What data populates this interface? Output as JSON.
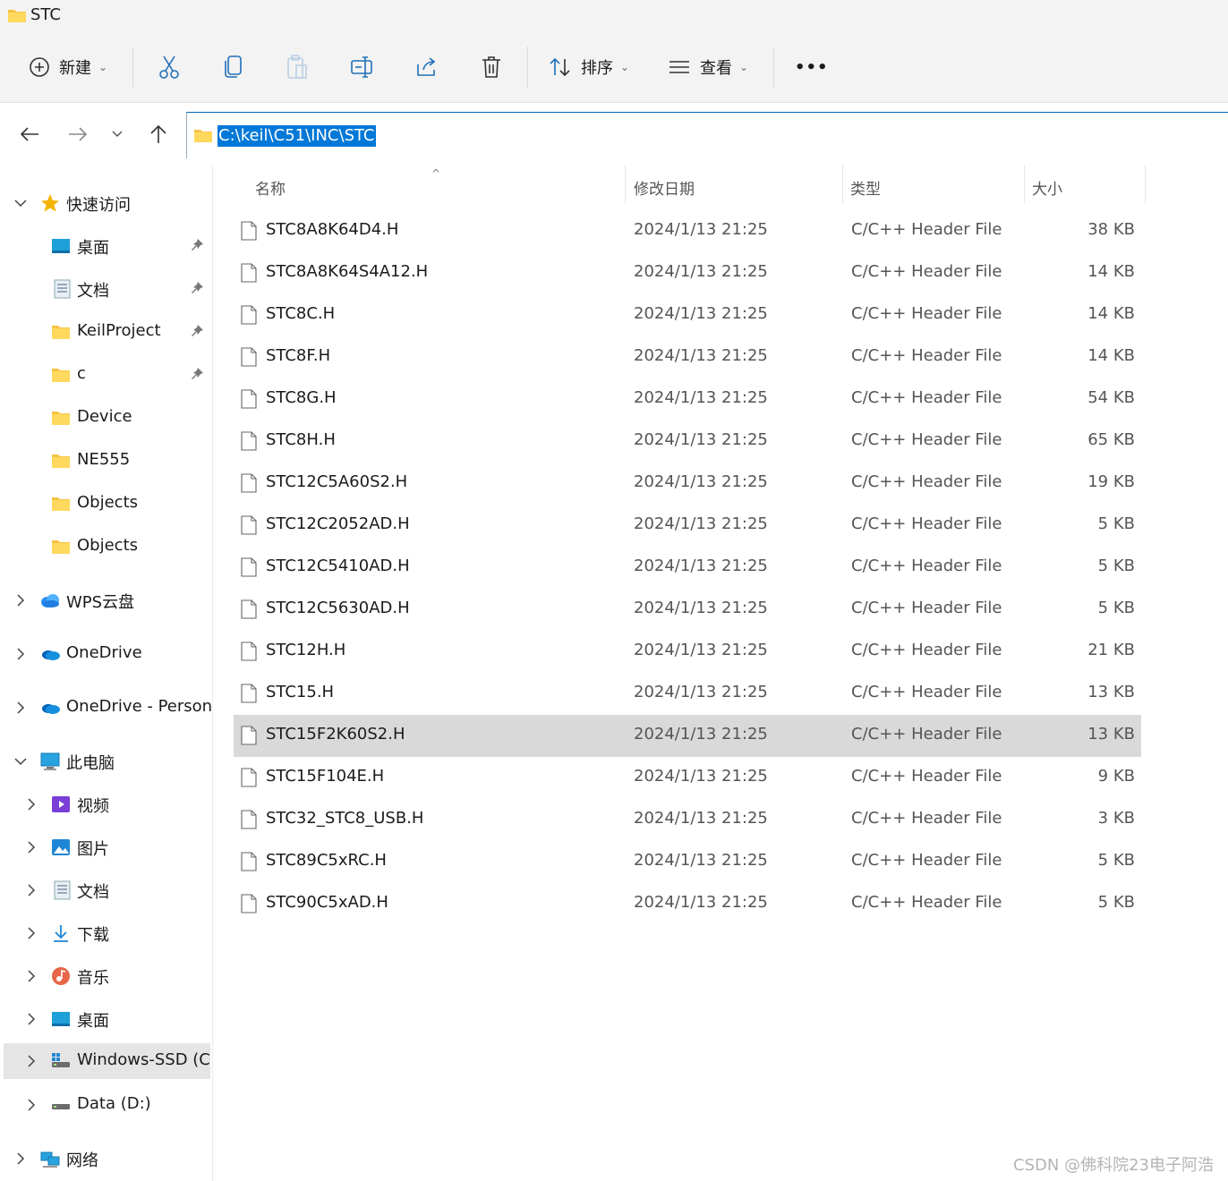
{
  "window": {
    "title": "STC"
  },
  "toolbar": {
    "new_label": "新建",
    "sort_label": "排序",
    "view_label": "查看",
    "more_label": "•••"
  },
  "address": {
    "path": "C:\\keil\\C51\\INC\\STC"
  },
  "sidebar": {
    "quick_access": "快速访问",
    "pinned": [
      "桌面",
      "文档",
      "KeilProject",
      "c"
    ],
    "folders": [
      "Device",
      "NE555",
      "Objects",
      "Objects"
    ],
    "wps": "WPS云盘",
    "onedrive": "OneDrive",
    "onedrive_personal": "OneDrive - Personal",
    "this_pc": "此电脑",
    "pc_items": [
      "视频",
      "图片",
      "文档",
      "下载",
      "音乐",
      "桌面"
    ],
    "drive_c": "Windows-SSD (C:)",
    "drive_d": "Data (D:)",
    "network": "网络"
  },
  "columns": {
    "name": "名称",
    "modified": "修改日期",
    "type": "类型",
    "size": "大小"
  },
  "files": [
    {
      "name": "STC8A8K64D4.H",
      "date": "2024/1/13 21:25",
      "type": "C/C++ Header File",
      "size": "38 KB"
    },
    {
      "name": "STC8A8K64S4A12.H",
      "date": "2024/1/13 21:25",
      "type": "C/C++ Header File",
      "size": "14 KB"
    },
    {
      "name": "STC8C.H",
      "date": "2024/1/13 21:25",
      "type": "C/C++ Header File",
      "size": "14 KB"
    },
    {
      "name": "STC8F.H",
      "date": "2024/1/13 21:25",
      "type": "C/C++ Header File",
      "size": "14 KB"
    },
    {
      "name": "STC8G.H",
      "date": "2024/1/13 21:25",
      "type": "C/C++ Header File",
      "size": "54 KB"
    },
    {
      "name": "STC8H.H",
      "date": "2024/1/13 21:25",
      "type": "C/C++ Header File",
      "size": "65 KB"
    },
    {
      "name": "STC12C5A60S2.H",
      "date": "2024/1/13 21:25",
      "type": "C/C++ Header File",
      "size": "19 KB"
    },
    {
      "name": "STC12C2052AD.H",
      "date": "2024/1/13 21:25",
      "type": "C/C++ Header File",
      "size": "5 KB"
    },
    {
      "name": "STC12C5410AD.H",
      "date": "2024/1/13 21:25",
      "type": "C/C++ Header File",
      "size": "5 KB"
    },
    {
      "name": "STC12C5630AD.H",
      "date": "2024/1/13 21:25",
      "type": "C/C++ Header File",
      "size": "5 KB"
    },
    {
      "name": "STC12H.H",
      "date": "2024/1/13 21:25",
      "type": "C/C++ Header File",
      "size": "21 KB"
    },
    {
      "name": "STC15.H",
      "date": "2024/1/13 21:25",
      "type": "C/C++ Header File",
      "size": "13 KB"
    },
    {
      "name": "STC15F2K60S2.H",
      "date": "2024/1/13 21:25",
      "type": "C/C++ Header File",
      "size": "13 KB",
      "selected": true
    },
    {
      "name": "STC15F104E.H",
      "date": "2024/1/13 21:25",
      "type": "C/C++ Header File",
      "size": "9 KB"
    },
    {
      "name": "STC32_STC8_USB.H",
      "date": "2024/1/13 21:25",
      "type": "C/C++ Header File",
      "size": "3 KB"
    },
    {
      "name": "STC89C5xRC.H",
      "date": "2024/1/13 21:25",
      "type": "C/C++ Header File",
      "size": "5 KB"
    },
    {
      "name": "STC90C5xAD.H",
      "date": "2024/1/13 21:25",
      "type": "C/C++ Header File",
      "size": "5 KB"
    }
  ],
  "watermark": "CSDN @佛科院23电子阿浩",
  "colors": {
    "accent": "#0078d7",
    "folder": "#f6c343",
    "selected_row": "#d9d9d9"
  }
}
